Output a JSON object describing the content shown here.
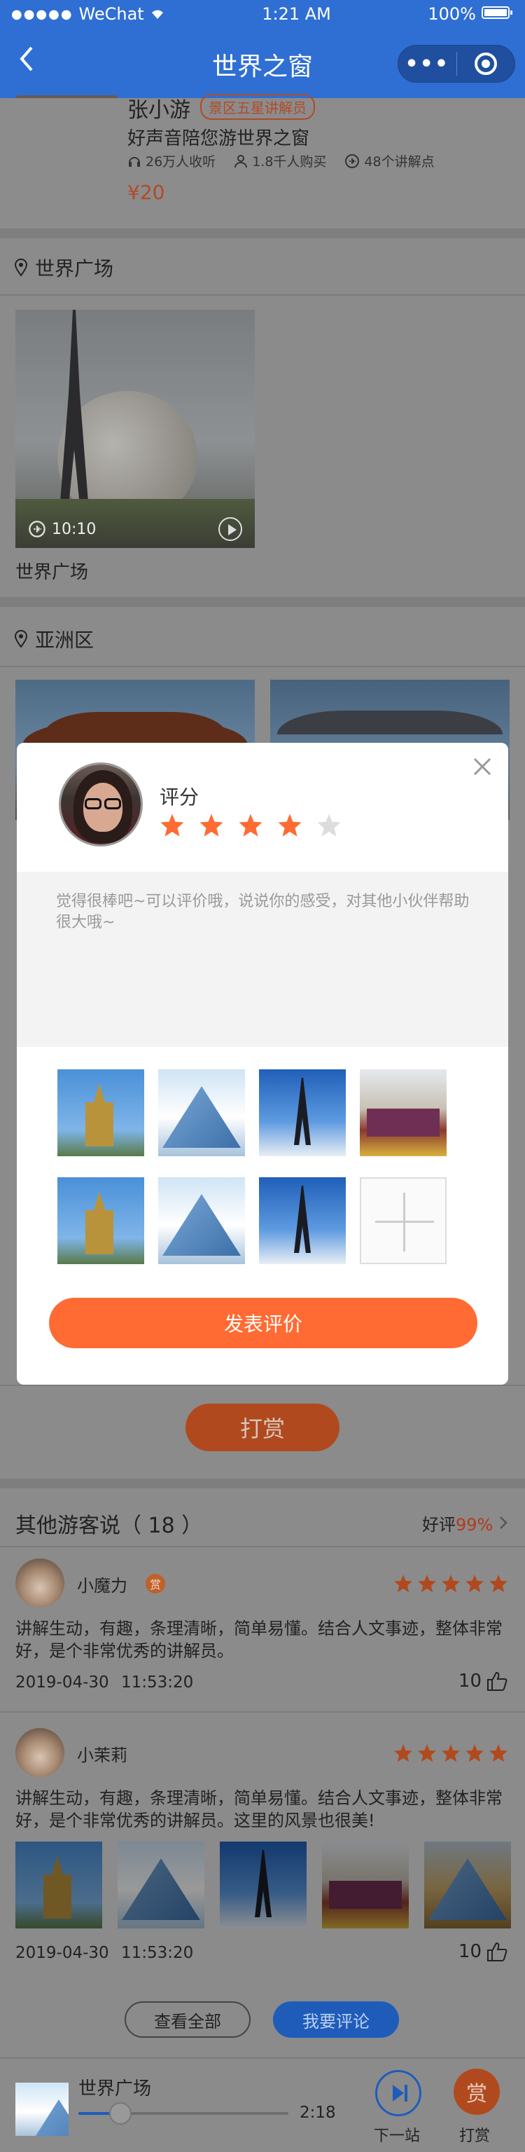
{
  "status_bar": {
    "carrier": "WeChat",
    "time": "1:21 AM",
    "battery": "100%"
  },
  "nav": {
    "back_icon": "chevron-left-icon",
    "title": "世界之窗",
    "more": "•••",
    "close_icon": "target-icon",
    "color": "#2f6fd3"
  },
  "guide": {
    "name": "张小游",
    "badge": "景区五星讲解员",
    "desc": "好声音陪您游世界之窗",
    "stats": {
      "listeners": "26万人收听",
      "buyers": "1.8千人购买",
      "points": "48个讲解点"
    },
    "price": "¥20"
  },
  "sections": {
    "plaza": {
      "title": "世界广场",
      "video_duration": "10:10",
      "video_caption": "世界广场"
    },
    "asia": {
      "title": "亚洲区"
    }
  },
  "modal": {
    "rating_label": "评分",
    "rating": 4,
    "rating_max": 5,
    "placeholder": "觉得很棒吧~可以评价哦，说说你的感受，对其他小伙伴帮助很大哦~",
    "photos": [
      "castle",
      "pyramid",
      "eiffel",
      "temple",
      "castle",
      "pyramid",
      "eiffel"
    ],
    "submit": "发表评价",
    "accent": "#ff6b32"
  },
  "reward_button": "打赏",
  "comments": {
    "header": "其他游客说（ 18 ）",
    "rating_prefix": "好评",
    "rating_value": "99%",
    "items": [
      {
        "name": "小魔力",
        "tipped_badge": "赏",
        "stars": 5,
        "text": "讲解生动，有趣，条理清晰，简单易懂。结合人文事迹，整体非常好，是个非常优秀的讲解员。",
        "date": "2019-04-30",
        "time": "11:53:20",
        "likes": "10"
      },
      {
        "name": "小茉莉",
        "stars": 5,
        "text": "讲解生动，有趣，条理清晰，简单易懂。结合人文事迹，整体非常好，是个非常优秀的讲解员。这里的风景也很美!",
        "date": "2019-04-30",
        "time": "11:53:20",
        "likes": "10",
        "photos": [
          "castle",
          "pyramid",
          "eiffel",
          "temple",
          "sphinx"
        ]
      }
    ],
    "view_all": "查看全部",
    "write": "我要评论"
  },
  "player": {
    "title": "世界广场",
    "time": "2:18",
    "progress": 0.2,
    "next_label": "下一站",
    "reward_icon_text": "赏",
    "reward_label": "打赏"
  }
}
